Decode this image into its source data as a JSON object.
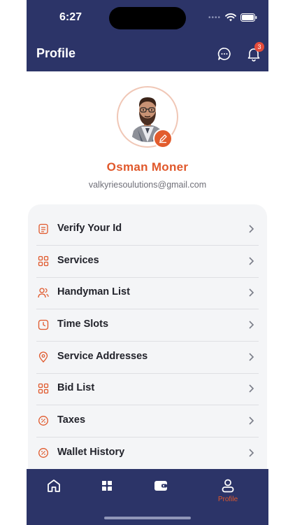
{
  "status_bar": {
    "time": "6:27",
    "signal_dots": "••••"
  },
  "header": {
    "title": "Profile",
    "chat_icon": "chat-bubble-icon",
    "notifications_icon": "bell-icon",
    "notification_count": "3"
  },
  "profile": {
    "name": "Osman Moner",
    "email": "valkyriesoulutions@gmail.com",
    "edit_icon": "pencil-icon"
  },
  "menu": {
    "items": [
      {
        "label": "Verify Your Id",
        "icon": "id-card-icon"
      },
      {
        "label": "Services",
        "icon": "grid-icon"
      },
      {
        "label": "Handyman List",
        "icon": "users-icon"
      },
      {
        "label": "Time Slots",
        "icon": "clock-icon"
      },
      {
        "label": "Service Addresses",
        "icon": "location-pin-icon"
      },
      {
        "label": "Bid List",
        "icon": "grid-icon"
      },
      {
        "label": "Taxes",
        "icon": "tax-badge-icon"
      },
      {
        "label": "Wallet History",
        "icon": "tax-badge-icon"
      }
    ]
  },
  "bottom_nav": {
    "items": [
      {
        "icon": "home-icon",
        "label": ""
      },
      {
        "icon": "services-icon",
        "label": ""
      },
      {
        "icon": "wallet-icon",
        "label": ""
      },
      {
        "icon": "profile-icon",
        "label": "Profile",
        "active": true
      }
    ]
  },
  "colors": {
    "primary": "#2c3468",
    "accent": "#e0582b",
    "badge": "#e44b3a",
    "menu_background": "#f4f5f7"
  }
}
